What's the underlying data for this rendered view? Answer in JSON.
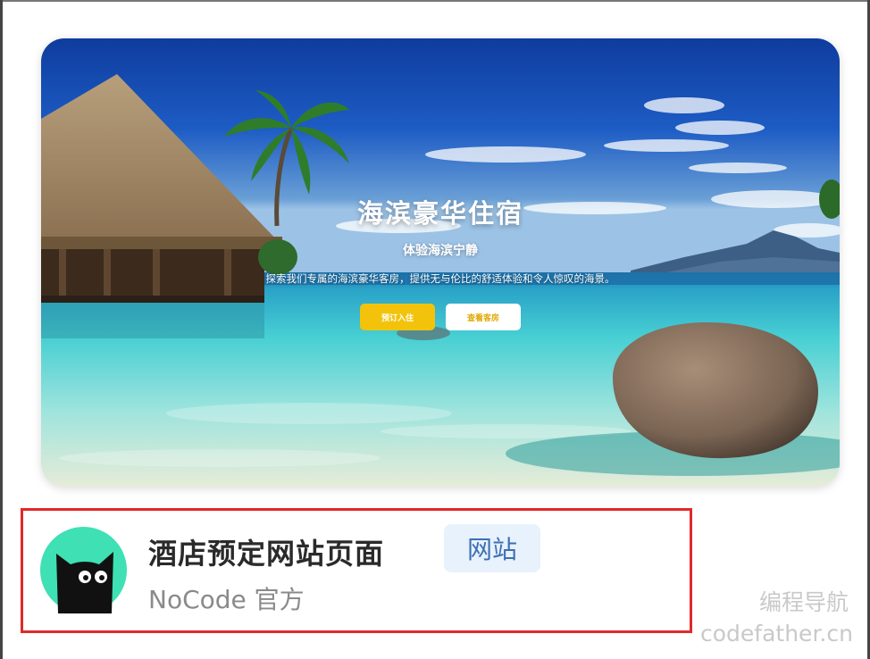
{
  "hero": {
    "title": "海滨豪华住宿",
    "subtitle": "体验海滨宁静",
    "description": "探索我们专属的海滨豪华客房，提供无与伦比的舒适体验和令人惊叹的海景。",
    "primary_button": "预订入住",
    "secondary_button": "查看客房"
  },
  "card": {
    "title": "酒店预定网站页面",
    "badge": "网站",
    "author": "NoCode 官方"
  },
  "watermark": {
    "line1": "编程导航",
    "line2": "codefather.cn"
  },
  "colors": {
    "accent_yellow": "#f2c30a",
    "badge_bg": "#e7f2fc",
    "badge_text": "#3d6fb5",
    "highlight_border": "#e02a2a",
    "avatar_bg": "#3ee0b4"
  },
  "icons": {
    "avatar": "black-cat-icon"
  }
}
